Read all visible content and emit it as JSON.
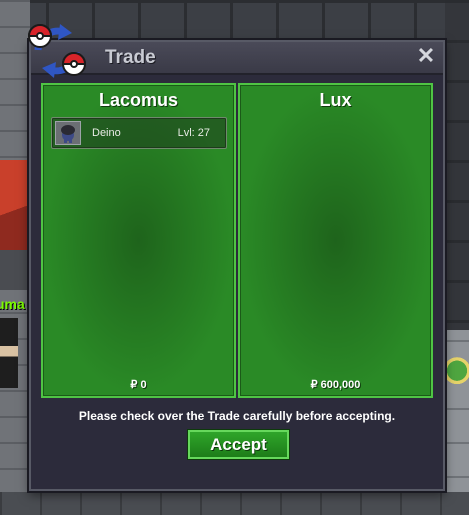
{
  "window": {
    "title": "Trade",
    "close_label": "✕"
  },
  "left_panel": {
    "player_name": "Lacomus",
    "items": [
      {
        "name": "Deino",
        "level": "Lvl: 27"
      }
    ],
    "money": "₽ 0"
  },
  "right_panel": {
    "player_name": "Lux",
    "items": [],
    "money": "₽ 600,000"
  },
  "notice": "Please check over the Trade carefully before accepting.",
  "accept_label": "Accept",
  "background": {
    "npc_name": "uma"
  },
  "colors": {
    "panel_green": "#2a8a26",
    "panel_border": "#4fc544",
    "window_bg": "#2c2b3b",
    "npc_name_green": "#7CFC00"
  }
}
